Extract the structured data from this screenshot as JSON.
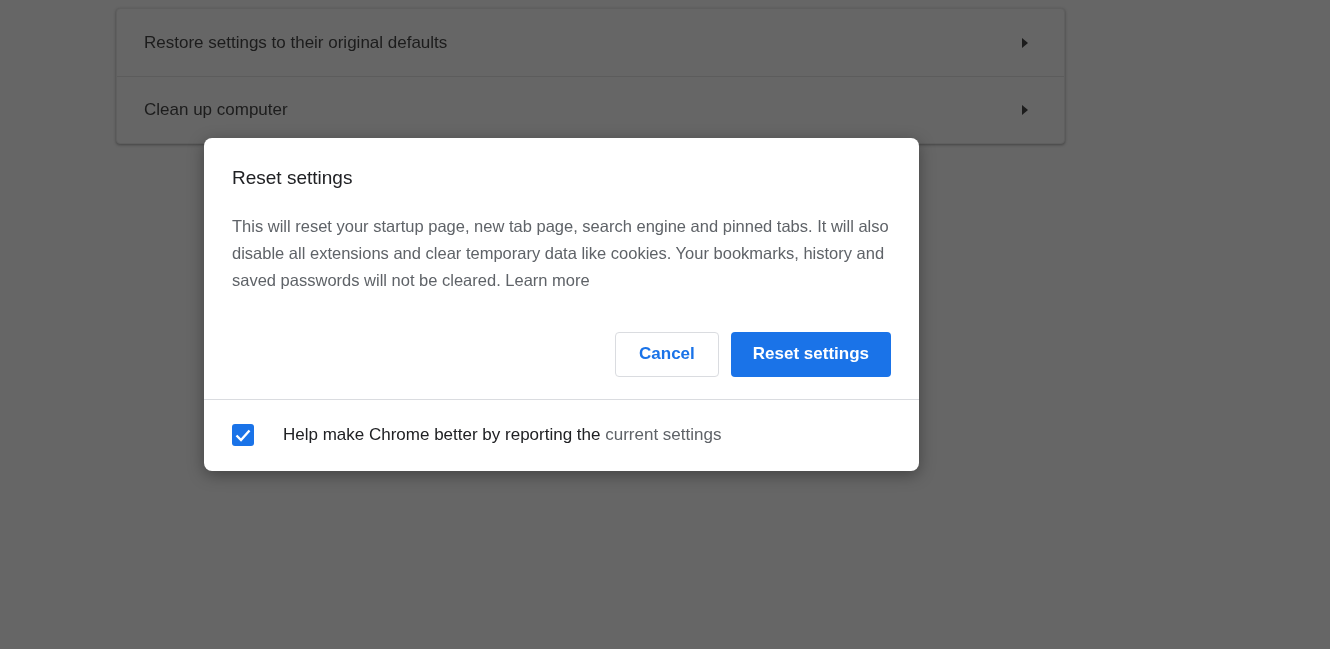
{
  "settings_rows": [
    {
      "label": "Restore settings to their original defaults"
    },
    {
      "label": "Clean up computer"
    }
  ],
  "dialog": {
    "title": "Reset settings",
    "body": "This will reset your startup page, new tab page, search engine and pinned tabs. It will also disable all extensions and clear temporary data like cookies. Your bookmarks, history and saved passwords will not be cleared.",
    "body_link": "Learn more",
    "buttons": [
      {
        "label": "Cancel",
        "kind": "secondary"
      },
      {
        "label": "Reset settings",
        "kind": "primary"
      }
    ],
    "report": {
      "checked": true,
      "text": "Help make Chrome better by reporting the",
      "link": "current settings"
    }
  }
}
